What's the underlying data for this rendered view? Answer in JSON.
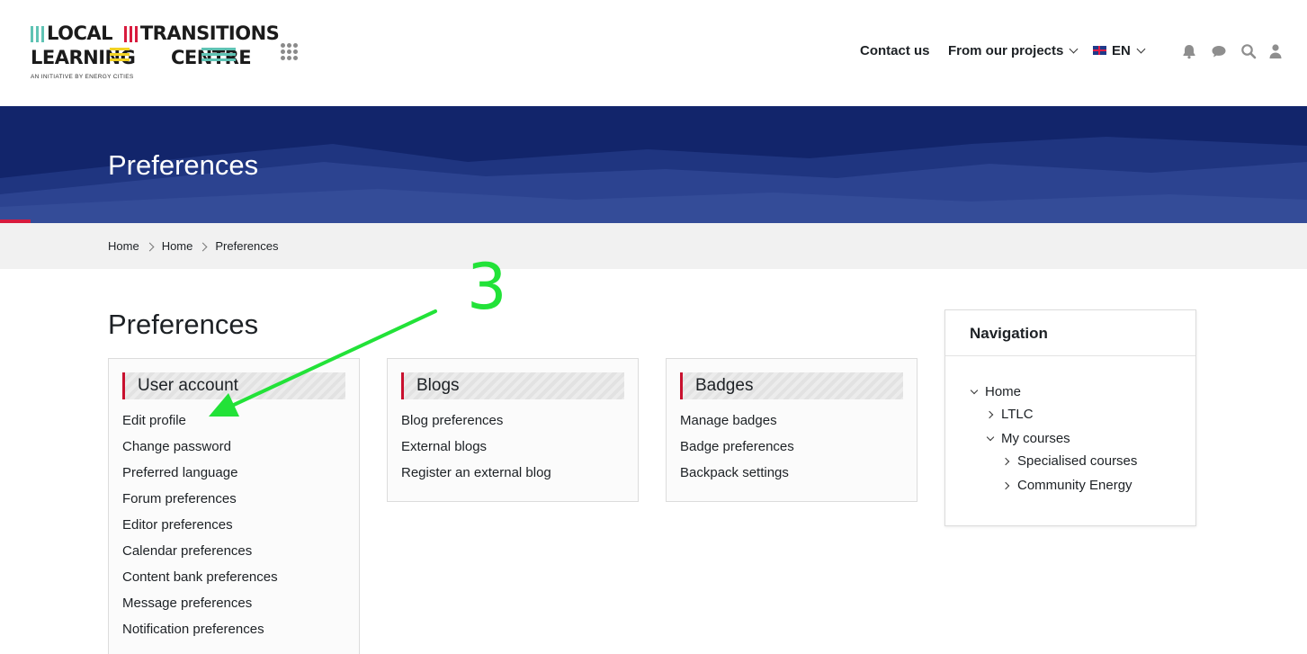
{
  "header": {
    "logo": {
      "line1_a": "LOCAL",
      "line1_b": "TRANSITIONS",
      "line2_a": "LEARNING",
      "line2_b": "CENTRE",
      "subtitle": "AN INITIATIVE BY ENERGY CITIES"
    },
    "nav": {
      "contact": "Contact us",
      "projects": "From our projects",
      "language": "EN"
    },
    "icons": [
      "apps-grid-icon",
      "bell-icon",
      "chat-icon",
      "search-icon",
      "user-icon"
    ]
  },
  "banner": {
    "title": "Preferences"
  },
  "breadcrumb": [
    "Home",
    "Home",
    "Preferences"
  ],
  "main": {
    "title": "Preferences",
    "cards": [
      {
        "title": "User account",
        "links": [
          "Edit profile",
          "Change password",
          "Preferred language",
          "Forum preferences",
          "Editor preferences",
          "Calendar preferences",
          "Content bank preferences",
          "Message preferences",
          "Notification preferences"
        ]
      },
      {
        "title": "Blogs",
        "links": [
          "Blog preferences",
          "External blogs",
          "Register an external blog"
        ]
      },
      {
        "title": "Badges",
        "links": [
          "Manage badges",
          "Badge preferences",
          "Backpack settings"
        ]
      }
    ]
  },
  "navigation": {
    "title": "Navigation",
    "tree": {
      "home": "Home",
      "ltlc": "LTLC",
      "my_courses": "My courses",
      "specialised": "Specialised courses",
      "community": "Community Energy"
    }
  },
  "annotation": {
    "step_number": "3",
    "color": "#22e238"
  },
  "colors": {
    "banner": "#12256b",
    "accent_red": "#c8102e",
    "logo_teal": "#5fc3b4",
    "logo_red": "#d81b3e",
    "logo_yellow": "#f2d224"
  }
}
